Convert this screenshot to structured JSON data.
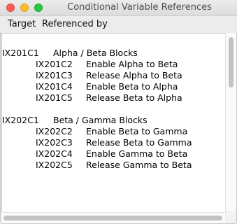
{
  "window": {
    "title": "Conditional Variable References"
  },
  "menubar": {
    "items": [
      "Target",
      "Referenced by"
    ]
  },
  "groups": [
    {
      "id": "IX201C1",
      "name": "Alpha / Beta Blocks",
      "rows": [
        {
          "id": "IX201C2",
          "description": "Enable Alpha to Beta"
        },
        {
          "id": "IX201C3",
          "description": "Release Alpha to Beta"
        },
        {
          "id": "IX201C4",
          "description": "Enable Beta to Alpha"
        },
        {
          "id": "IX201C5",
          "description": "Release Beta to Alpha"
        }
      ]
    },
    {
      "id": "IX202C1",
      "name": "Beta / Gamma Blocks",
      "rows": [
        {
          "id": "IX202C2",
          "description": "Enable Beta to Gamma"
        },
        {
          "id": "IX202C3",
          "description": "Release Beta to Gamma"
        },
        {
          "id": "IX202C4",
          "description": "Enable Gamma to Beta"
        },
        {
          "id": "IX202C5",
          "description": "Release Gamma to Beta"
        }
      ]
    }
  ]
}
